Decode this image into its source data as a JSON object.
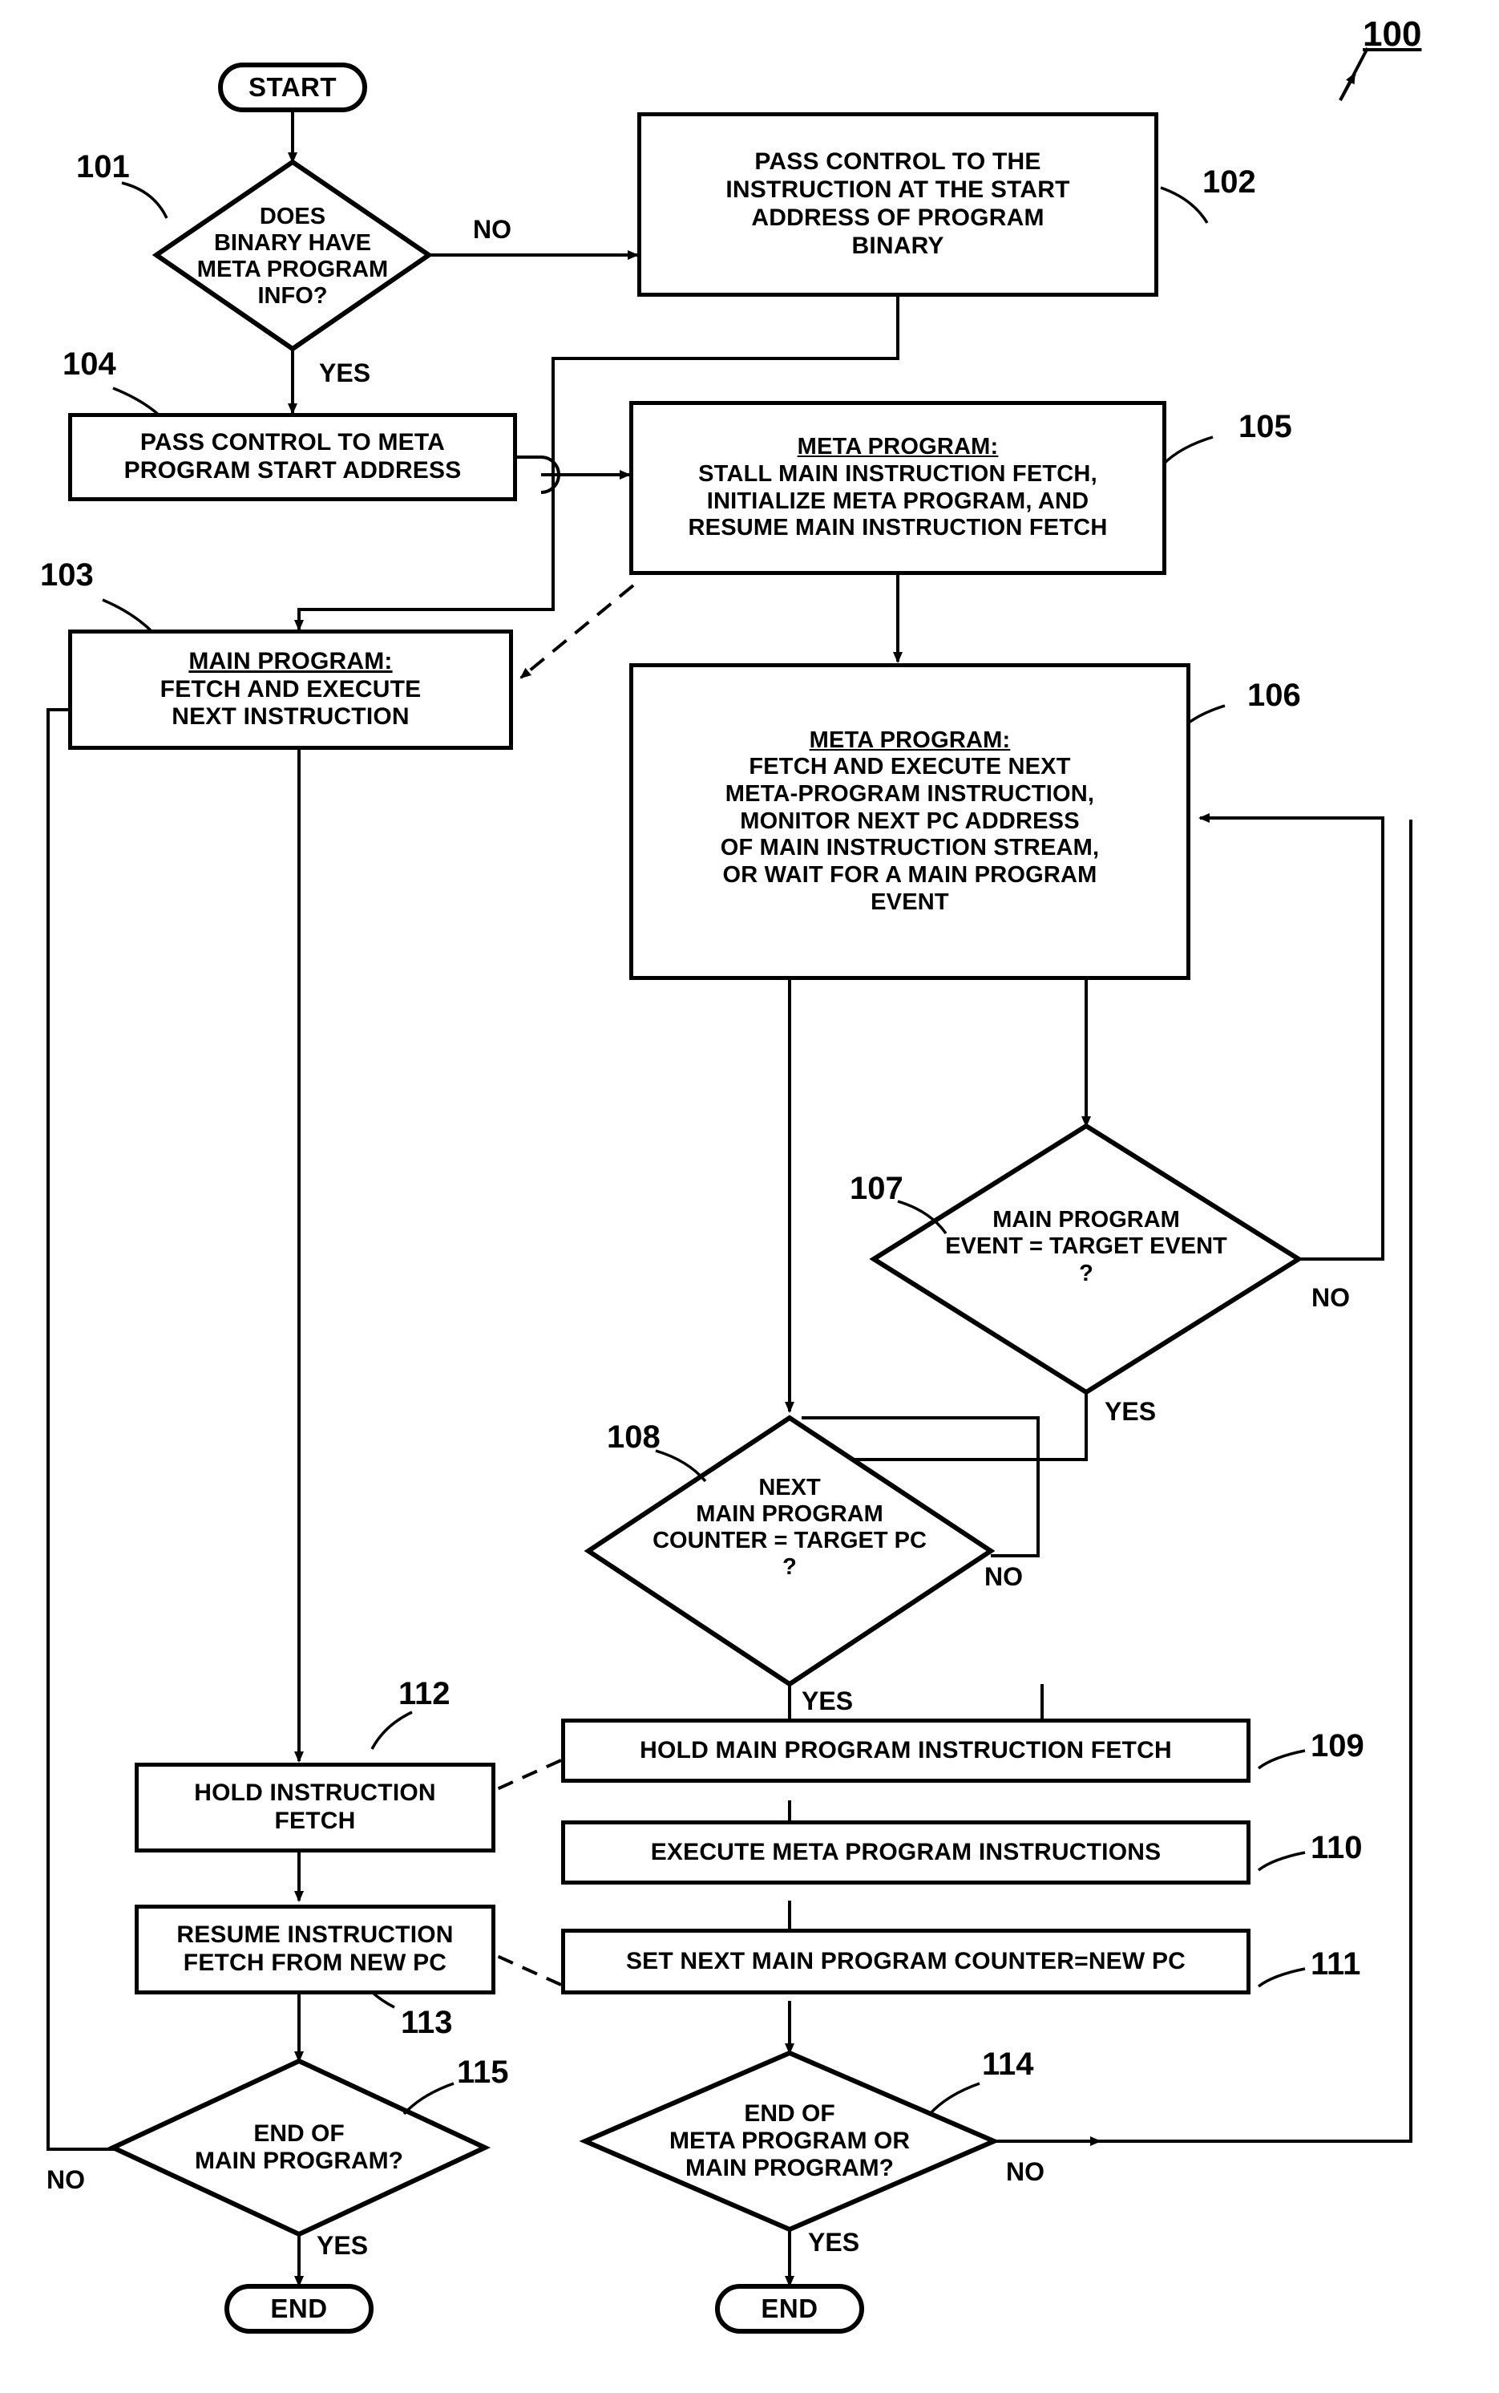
{
  "figure": {
    "label": "100"
  },
  "nodes": {
    "start": {
      "id": "start",
      "text": "START",
      "type": "terminator"
    },
    "d101": {
      "ref": "101",
      "lines": [
        "DOES",
        "BINARY HAVE",
        "META PROGRAM",
        "INFO?"
      ],
      "yes": "YES",
      "no": "NO"
    },
    "b102": {
      "ref": "102",
      "lines": [
        "PASS CONTROL TO THE",
        "INSTRUCTION AT THE START",
        "ADDRESS OF PROGRAM",
        "BINARY"
      ]
    },
    "b104": {
      "ref": "104",
      "lines": [
        "PASS CONTROL TO META",
        "PROGRAM START ADDRESS"
      ]
    },
    "b105": {
      "ref": "105",
      "title": "META PROGRAM:",
      "lines": [
        "STALL MAIN INSTRUCTION FETCH,",
        "INITIALIZE META PROGRAM, AND",
        "RESUME MAIN INSTRUCTION FETCH"
      ]
    },
    "b103": {
      "ref": "103",
      "title": "MAIN PROGRAM:",
      "lines": [
        "FETCH AND EXECUTE",
        "NEXT INSTRUCTION"
      ]
    },
    "b106": {
      "ref": "106",
      "title": "META PROGRAM:",
      "lines": [
        "FETCH AND EXECUTE NEXT",
        "META-PROGRAM INSTRUCTION,",
        "MONITOR NEXT PC ADDRESS",
        "OF MAIN INSTRUCTION STREAM,",
        "OR WAIT FOR A MAIN PROGRAM",
        "EVENT"
      ]
    },
    "d107": {
      "ref": "107",
      "lines": [
        "MAIN PROGRAM",
        "EVENT = TARGET EVENT",
        "?"
      ],
      "yes": "YES",
      "no": "NO"
    },
    "d108": {
      "ref": "108",
      "lines": [
        "NEXT",
        "MAIN PROGRAM",
        "COUNTER = TARGET PC",
        "?"
      ],
      "yes": "YES",
      "no": "NO"
    },
    "b112": {
      "ref": "112",
      "lines": [
        "HOLD INSTRUCTION",
        "FETCH"
      ]
    },
    "b109": {
      "ref": "109",
      "lines": [
        "HOLD MAIN PROGRAM INSTRUCTION FETCH"
      ]
    },
    "b110": {
      "ref": "110",
      "lines": [
        "EXECUTE META PROGRAM INSTRUCTIONS"
      ]
    },
    "b113": {
      "ref": "113",
      "lines": [
        "RESUME INSTRUCTION",
        "FETCH FROM NEW PC"
      ]
    },
    "b111": {
      "ref": "111",
      "lines": [
        "SET NEXT MAIN PROGRAM COUNTER=NEW PC"
      ]
    },
    "d115": {
      "ref": "115",
      "lines": [
        "END OF",
        "MAIN PROGRAM?"
      ],
      "yes": "YES",
      "no": "NO"
    },
    "d114": {
      "ref": "114",
      "lines": [
        "END OF",
        "META PROGRAM OR",
        "MAIN PROGRAM?"
      ],
      "yes": "YES",
      "no": "NO"
    },
    "end_left": {
      "text": "END",
      "type": "terminator"
    },
    "end_right": {
      "text": "END",
      "type": "terminator"
    }
  },
  "colors": {
    "stroke": "#000000",
    "fill": "#ffffff"
  }
}
